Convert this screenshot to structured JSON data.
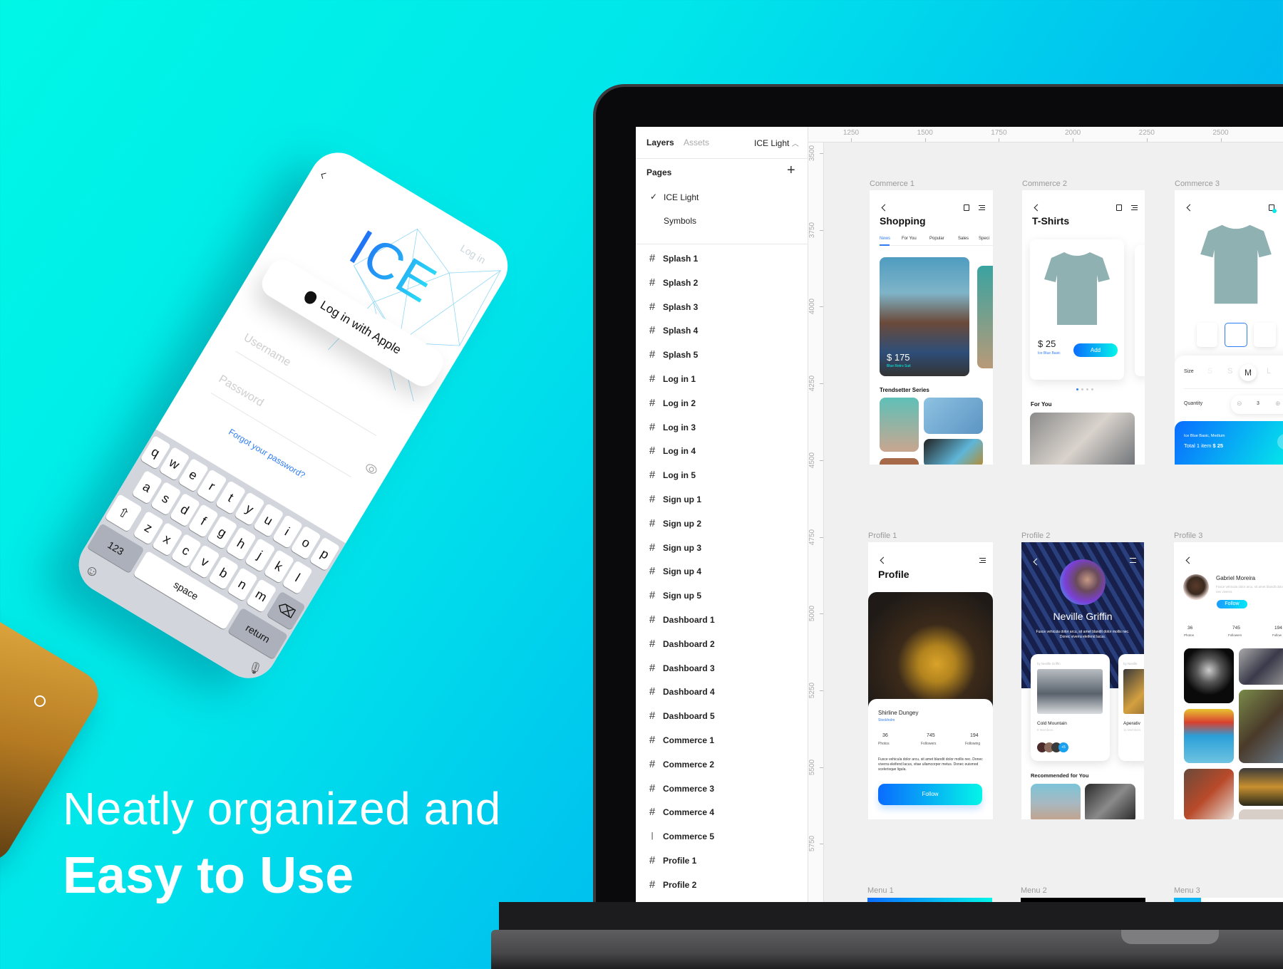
{
  "hero": {
    "line1": "Neatly organized and",
    "line2": "Easy to Use"
  },
  "colors": {
    "accent_blue": "#0a6cff",
    "accent_cyan": "#04f5e8",
    "link_blue": "#2f7df5"
  },
  "phone": {
    "logo": "ICE",
    "side_link": "Log in",
    "apple_button": "Log in with Apple",
    "username_placeholder": "Username",
    "password_placeholder": "Password",
    "forgot_link": "Forgot your password?",
    "keyboard": {
      "row1": [
        "q",
        "w",
        "e",
        "r",
        "t",
        "y",
        "u",
        "i",
        "o",
        "p"
      ],
      "row2": [
        "a",
        "s",
        "d",
        "f",
        "g",
        "h",
        "j",
        "k",
        "l"
      ],
      "row3": [
        "z",
        "x",
        "c",
        "v",
        "b",
        "n",
        "m"
      ],
      "numbers_key": "123",
      "space_key": "space",
      "return_key": "return"
    },
    "icons": [
      "back-chevron-icon",
      "apple-icon",
      "eye-icon",
      "shift-icon",
      "backspace-icon",
      "emoji-icon",
      "microphone-icon"
    ]
  },
  "sidebar": {
    "tabs": [
      "Layers",
      "Assets"
    ],
    "page_selector": "ICE Light",
    "pages_title": "Pages",
    "pages": [
      {
        "label": "ICE Light",
        "checked": true
      },
      {
        "label": "Symbols",
        "checked": false
      }
    ],
    "layers": [
      {
        "label": "Splash 1",
        "icon": "frame-icon"
      },
      {
        "label": "Splash 2",
        "icon": "frame-icon"
      },
      {
        "label": "Splash 3",
        "icon": "frame-icon"
      },
      {
        "label": "Splash 4",
        "icon": "frame-icon"
      },
      {
        "label": "Splash 5",
        "icon": "frame-icon"
      },
      {
        "label": "Log in 1",
        "icon": "frame-icon"
      },
      {
        "label": "Log in 2",
        "icon": "frame-icon"
      },
      {
        "label": "Log in 3",
        "icon": "frame-icon"
      },
      {
        "label": "Log in 4",
        "icon": "frame-icon"
      },
      {
        "label": "Log in 5",
        "icon": "frame-icon"
      },
      {
        "label": "Sign up 1",
        "icon": "frame-icon"
      },
      {
        "label": "Sign up 2",
        "icon": "frame-icon"
      },
      {
        "label": "Sign up 3",
        "icon": "frame-icon"
      },
      {
        "label": "Sign up 4",
        "icon": "frame-icon"
      },
      {
        "label": "Sign up 5",
        "icon": "frame-icon"
      },
      {
        "label": "Dashboard 1",
        "icon": "frame-icon"
      },
      {
        "label": "Dashboard 2",
        "icon": "frame-icon"
      },
      {
        "label": "Dashboard 3",
        "icon": "frame-icon"
      },
      {
        "label": "Dashboard 4",
        "icon": "frame-icon"
      },
      {
        "label": "Dashboard 5",
        "icon": "frame-icon"
      },
      {
        "label": "Commerce 1",
        "icon": "frame-icon"
      },
      {
        "label": "Commerce 2",
        "icon": "frame-icon"
      },
      {
        "label": "Commerce 3",
        "icon": "frame-icon"
      },
      {
        "label": "Commerce 4",
        "icon": "frame-icon"
      },
      {
        "label": "Commerce 5",
        "icon": "line-icon"
      },
      {
        "label": "Profile 1",
        "icon": "frame-icon"
      },
      {
        "label": "Profile 2",
        "icon": "frame-icon"
      }
    ]
  },
  "rulers": {
    "x": [
      "1250",
      "1500",
      "1750",
      "2000",
      "2250",
      "2500"
    ],
    "y": [
      "3500",
      "3750",
      "4000",
      "4250",
      "4500",
      "4750",
      "5000",
      "5250",
      "5500",
      "5750"
    ]
  },
  "frames": {
    "commerce1": {
      "label": "Commerce 1",
      "title": "Shopping",
      "tabs": [
        "News",
        "For You",
        "Popular",
        "Sales",
        "Speci"
      ],
      "price": "$ 175",
      "product": "Blue Retro Suit",
      "section": "Trendsetter Series"
    },
    "commerce2": {
      "label": "Commerce 2",
      "title": "T-Shirts",
      "price": "$ 25",
      "product": "Ice Blue Basic",
      "add": "Add",
      "section": "For You"
    },
    "commerce3": {
      "label": "Commerce 3",
      "size_label": "Size",
      "sizes": [
        "S",
        "S",
        "M",
        "L"
      ],
      "selected_size": "M",
      "quantity_label": "Quantity",
      "quantity": "3",
      "summary": "Ice Blue Basic, Medium",
      "total_prefix": "Total 1 item",
      "total": "$ 25"
    },
    "profile1": {
      "label": "Profile 1",
      "title": "Profile",
      "name": "Shirline Dungey",
      "location": "Stockholm",
      "stats": [
        {
          "value": "36",
          "label": "Photos"
        },
        {
          "value": "745",
          "label": "Followers"
        },
        {
          "value": "194",
          "label": "Following"
        }
      ],
      "bio": "Fusce vehicula dolor arcu, sit amet blandit dolor mollis nec. Donec viverra eleifend lacus, vitae ullamcorper metus. Donec euismod scelerisque ligula.",
      "follow": "Follow"
    },
    "profile2": {
      "label": "Profile 2",
      "name": "Neville Griffin",
      "bio": "Fusce vehicula dolor arcu, sit amet blandit dolor mollis nec. Donec viverra eleifend lacus.",
      "card1": {
        "by": "by Neville Griffin",
        "title": "Cold Mountain",
        "members": "8 Members",
        "extra": "+5"
      },
      "card2": {
        "by": "by Neville",
        "title": "Aperativ",
        "members": "11 Members"
      },
      "section": "Recommended for You"
    },
    "profile3": {
      "label": "Profile 3",
      "name": "Gabriel Moreira",
      "bio": "Fusce vehicula dolor arcu, sit amet blandit dolor mollis nec viverra.",
      "follow": "Follow",
      "stats": [
        {
          "value": "36",
          "label": "Photos"
        },
        {
          "value": "745",
          "label": "Followers"
        },
        {
          "value": "194",
          "label": "Follow"
        }
      ]
    },
    "menus": [
      "Menu 1",
      "Menu 2",
      "Menu 3"
    ]
  }
}
